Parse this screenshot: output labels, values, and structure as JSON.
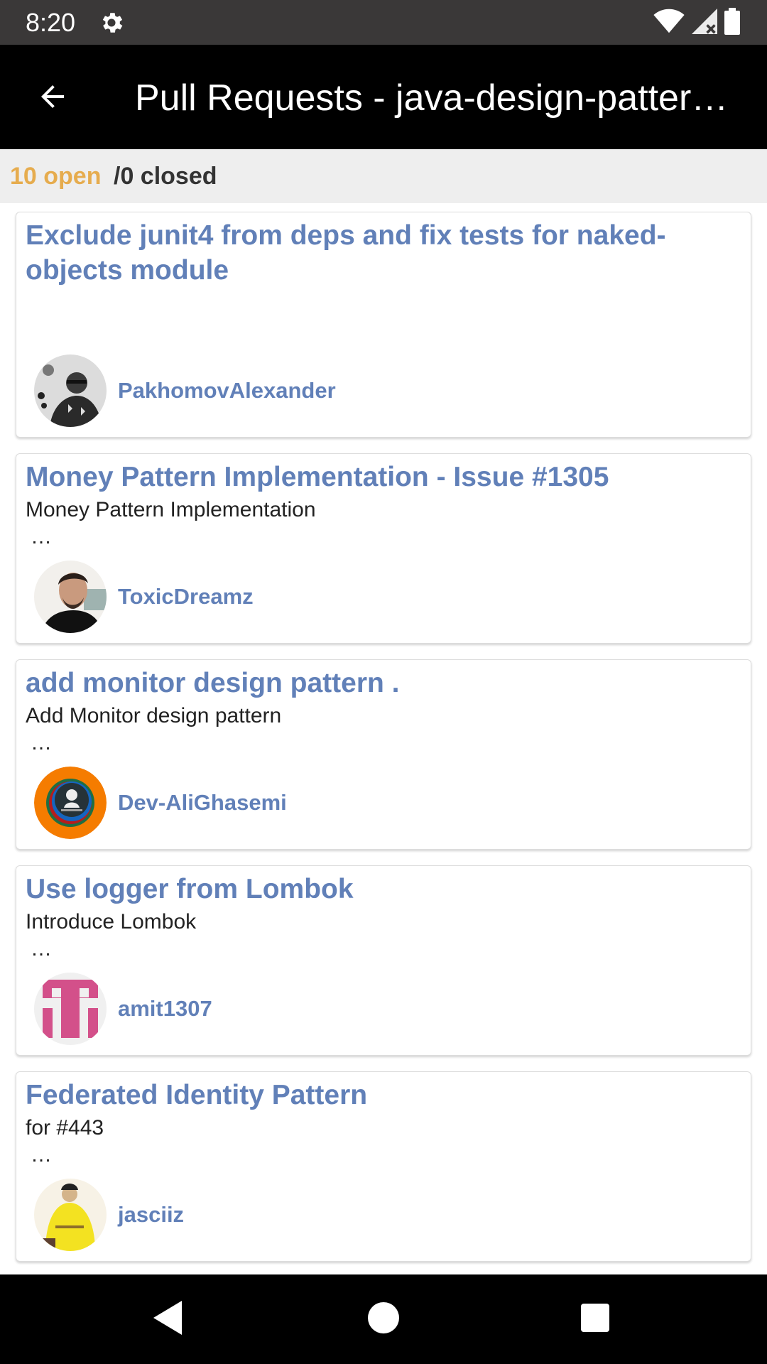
{
  "status_bar": {
    "time": "8:20"
  },
  "app_bar": {
    "title": "Pull Requests - java-design-patter…"
  },
  "summary": {
    "open": "10 open",
    "closed": "/0 closed"
  },
  "pull_requests": [
    {
      "title": "Exclude junit4 from deps and fix tests for naked-objects module",
      "body": "",
      "ellipsis": "",
      "author": "PakhomovAlexander"
    },
    {
      "title": "Money Pattern Implementation - Issue #1305",
      "body": "Money Pattern Implementation",
      "ellipsis": "…",
      "author": "ToxicDreamz"
    },
    {
      "title": "add monitor design pattern .",
      "body": "Add Monitor design pattern",
      "ellipsis": "…",
      "author": "Dev-AliGhasemi"
    },
    {
      "title": "Use logger from Lombok",
      "body": "Introduce Lombok",
      "ellipsis": "…",
      "author": "amit1307"
    },
    {
      "title": "Federated Identity Pattern",
      "body": "for #443",
      "ellipsis": "…",
      "author": "jasciiz"
    }
  ],
  "colors": {
    "accent_blue": "#6180b8",
    "open_orange": "#e6ac4e",
    "app_bar": "#000000",
    "status_bar": "#3a3838"
  }
}
